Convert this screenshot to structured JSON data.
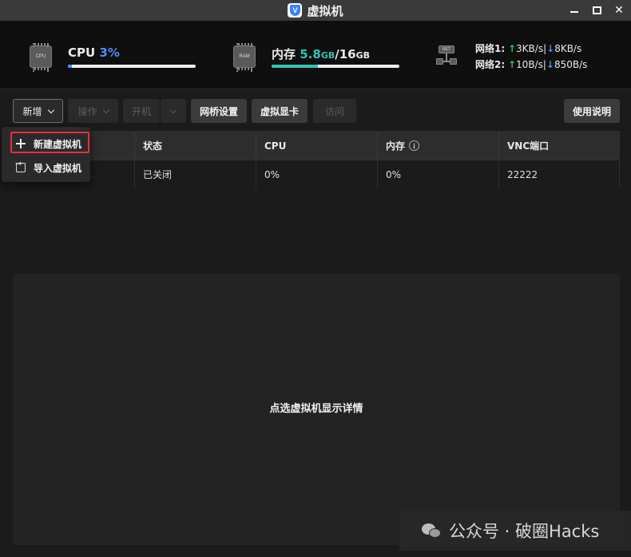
{
  "window": {
    "title": "虚拟机",
    "app_icon_letter": "V",
    "close_glyph": "✕"
  },
  "stats": {
    "cpu": {
      "label": "CPU",
      "value": "3%",
      "percent": 3,
      "icon_text": "CPU",
      "color": "#4f8ef7"
    },
    "memory": {
      "label": "内存",
      "used": "5.8",
      "used_unit": "GB",
      "separator": "/",
      "total": "16",
      "total_unit": "GB",
      "percent": 36,
      "icon_text": "RAM",
      "color": "#2fc4b2"
    },
    "network": {
      "icon_text": "NET",
      "rows": [
        {
          "label": "网络1:",
          "up": "3KB/s",
          "down": "8KB/s"
        },
        {
          "label": "网络2:",
          "up": "10B/s",
          "down": "850B/s"
        }
      ],
      "up_arrow": "↑",
      "down_arrow": "↓",
      "divider": "|"
    }
  },
  "toolbar": {
    "add": "新增",
    "operate": "操作",
    "power_on": "开机",
    "bridge": "网桥设置",
    "vgpu": "虚拟显卡",
    "visit": "访问",
    "help": "使用说明"
  },
  "dropdown": {
    "items": [
      {
        "label": "新建虚拟机",
        "icon": "plus-icon"
      },
      {
        "label": "导入虚拟机",
        "icon": "import-icon"
      }
    ]
  },
  "table": {
    "columns": [
      "状态",
      "CPU",
      "内存",
      "VNC端口"
    ],
    "info_glyph": "i",
    "rows": [
      {
        "status": "已关闭",
        "cpu": "0%",
        "memory": "0%",
        "vnc": "22222"
      }
    ]
  },
  "detail": {
    "placeholder": "点选虚拟机显示详情"
  },
  "watermark": {
    "text": "公众号 · 破圈Hacks"
  }
}
